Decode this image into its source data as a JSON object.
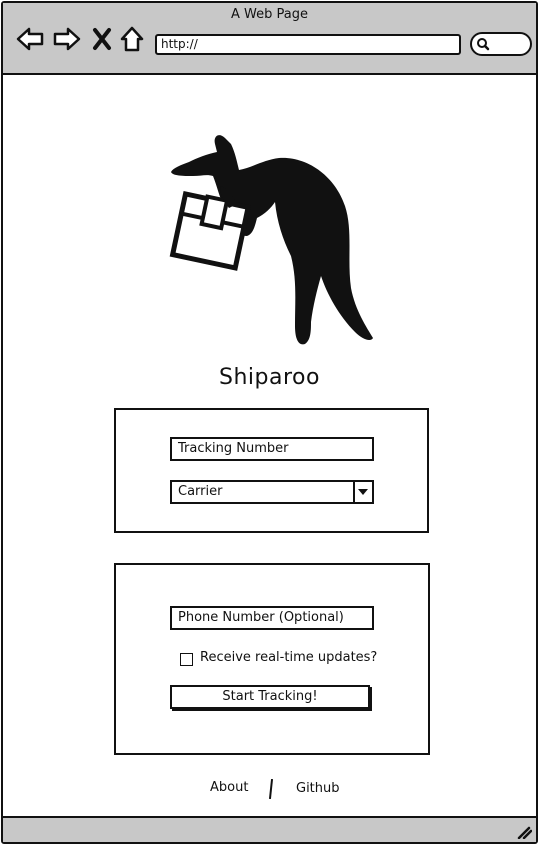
{
  "browser": {
    "title": "A Web Page",
    "url": "http://"
  },
  "app": {
    "brand": "Shiparoo",
    "logo_icon": "kangaroo-with-package-icon"
  },
  "tracking_form": {
    "tracking_placeholder": "Tracking Number",
    "carrier_selected": "Carrier"
  },
  "notify_form": {
    "phone_placeholder": "Phone Number (Optional)",
    "updates_label": "Receive real-time updates?",
    "updates_checked": false,
    "submit_label": "Start Tracking!"
  },
  "footer": {
    "about_label": "About",
    "github_label": "Github"
  }
}
